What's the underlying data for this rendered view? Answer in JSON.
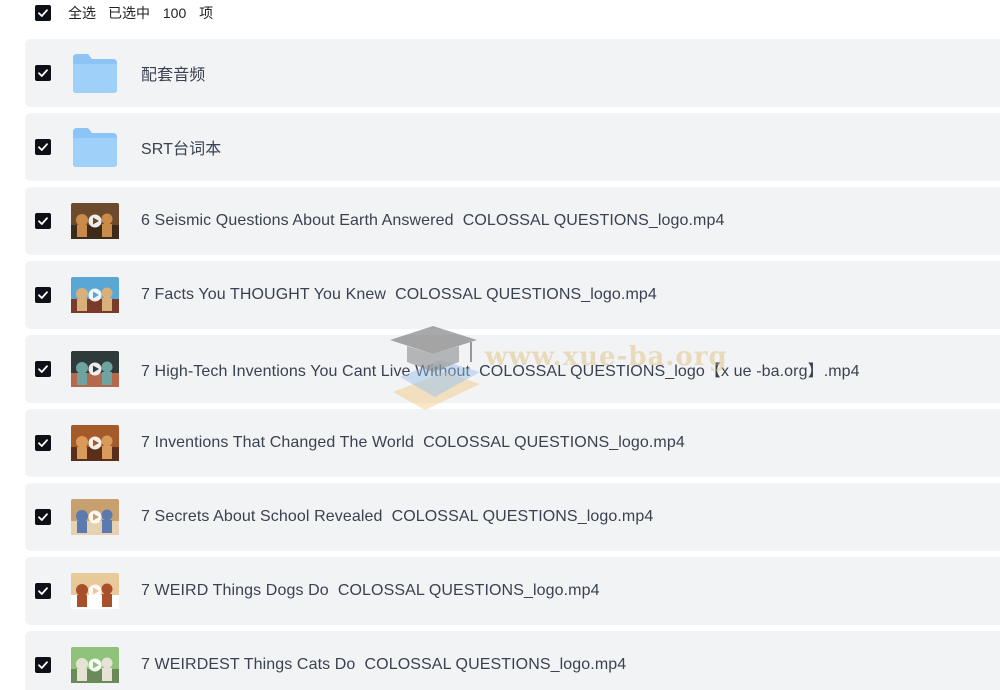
{
  "select_all": {
    "label": "全选",
    "selected_prefix": "已选中",
    "selected_count": "100",
    "selected_suffix": "项"
  },
  "items": [
    {
      "type": "folder",
      "icon": "folder-icon",
      "name": "配套音频"
    },
    {
      "type": "folder",
      "icon": "folder-icon",
      "name": "SRT台词本"
    },
    {
      "type": "video",
      "icon": "video-thumbnail",
      "name": "6 Seismic Questions About Earth Answered  COLOSSAL QUESTIONS_logo.mp4",
      "thumb_colors": [
        "#6b4a2e",
        "#c98a4a",
        "#3c2a1a"
      ]
    },
    {
      "type": "video",
      "icon": "video-thumbnail",
      "name": "7 Facts You THOUGHT You Knew  COLOSSAL QUESTIONS_logo.mp4",
      "thumb_colors": [
        "#5aa7d6",
        "#d9b07a",
        "#7a3b2a"
      ]
    },
    {
      "type": "video",
      "icon": "video-thumbnail",
      "name": "7 High-Tech Inventions You Cant Live Without  COLOSSAL QUESTIONS_logo【x ue -ba.org】.mp4",
      "thumb_colors": [
        "#2f3b3a",
        "#6fa3a0",
        "#b46a4a"
      ]
    },
    {
      "type": "video",
      "icon": "video-thumbnail",
      "name": "7 Inventions That Changed The World  COLOSSAL QUESTIONS_logo.mp4",
      "thumb_colors": [
        "#a55a2a",
        "#d99a5a",
        "#5a2e1a"
      ]
    },
    {
      "type": "video",
      "icon": "video-thumbnail",
      "name": "7 Secrets About School Revealed  COLOSSAL QUESTIONS_logo.mp4",
      "thumb_colors": [
        "#c8a070",
        "#5a7ab0",
        "#e6d2b0"
      ]
    },
    {
      "type": "video",
      "icon": "video-thumbnail",
      "name": "7 WEIRD Things Dogs Do  COLOSSAL QUESTIONS_logo.mp4",
      "thumb_colors": [
        "#e8c99a",
        "#a8502a",
        "#ffffff"
      ]
    },
    {
      "type": "video",
      "icon": "video-thumbnail",
      "name": "7 WEIRDEST Things Cats Do  COLOSSAL QUESTIONS_logo.mp4",
      "thumb_colors": [
        "#8fc27a",
        "#e6e2d6",
        "#6a8a5a"
      ]
    }
  ],
  "watermark": {
    "icon": "graduation-cap-logo",
    "text": "www.xue-ba.org"
  },
  "colors": {
    "checkbox": "#0d1117",
    "row_background": "#f2f3f5",
    "folder": "#8cc4f5",
    "text": "#3a4150"
  }
}
